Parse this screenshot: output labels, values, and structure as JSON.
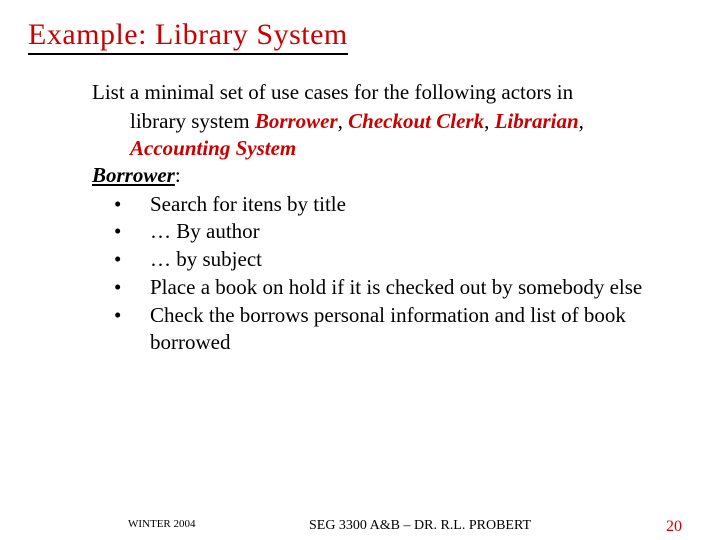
{
  "title": "Example:  Library System",
  "intro_lead": "List a minimal set of use cases for the following actors in",
  "intro_line2_prefix": "library system ",
  "actors": [
    "Borrower",
    "Checkout Clerk",
    "Librarian",
    "Accounting System"
  ],
  "section_label": "Borrower",
  "section_colon": ":",
  "bullets": [
    "Search for itens by title",
    "… By author",
    "… by subject",
    "Place a book on hold if it is checked out by somebody else",
    "Check the borrows personal information and list of book borrowed"
  ],
  "footer": {
    "left": "WINTER 2004",
    "center": "SEG 3300 A&B – DR. R.L. PROBERT",
    "right": "20"
  }
}
